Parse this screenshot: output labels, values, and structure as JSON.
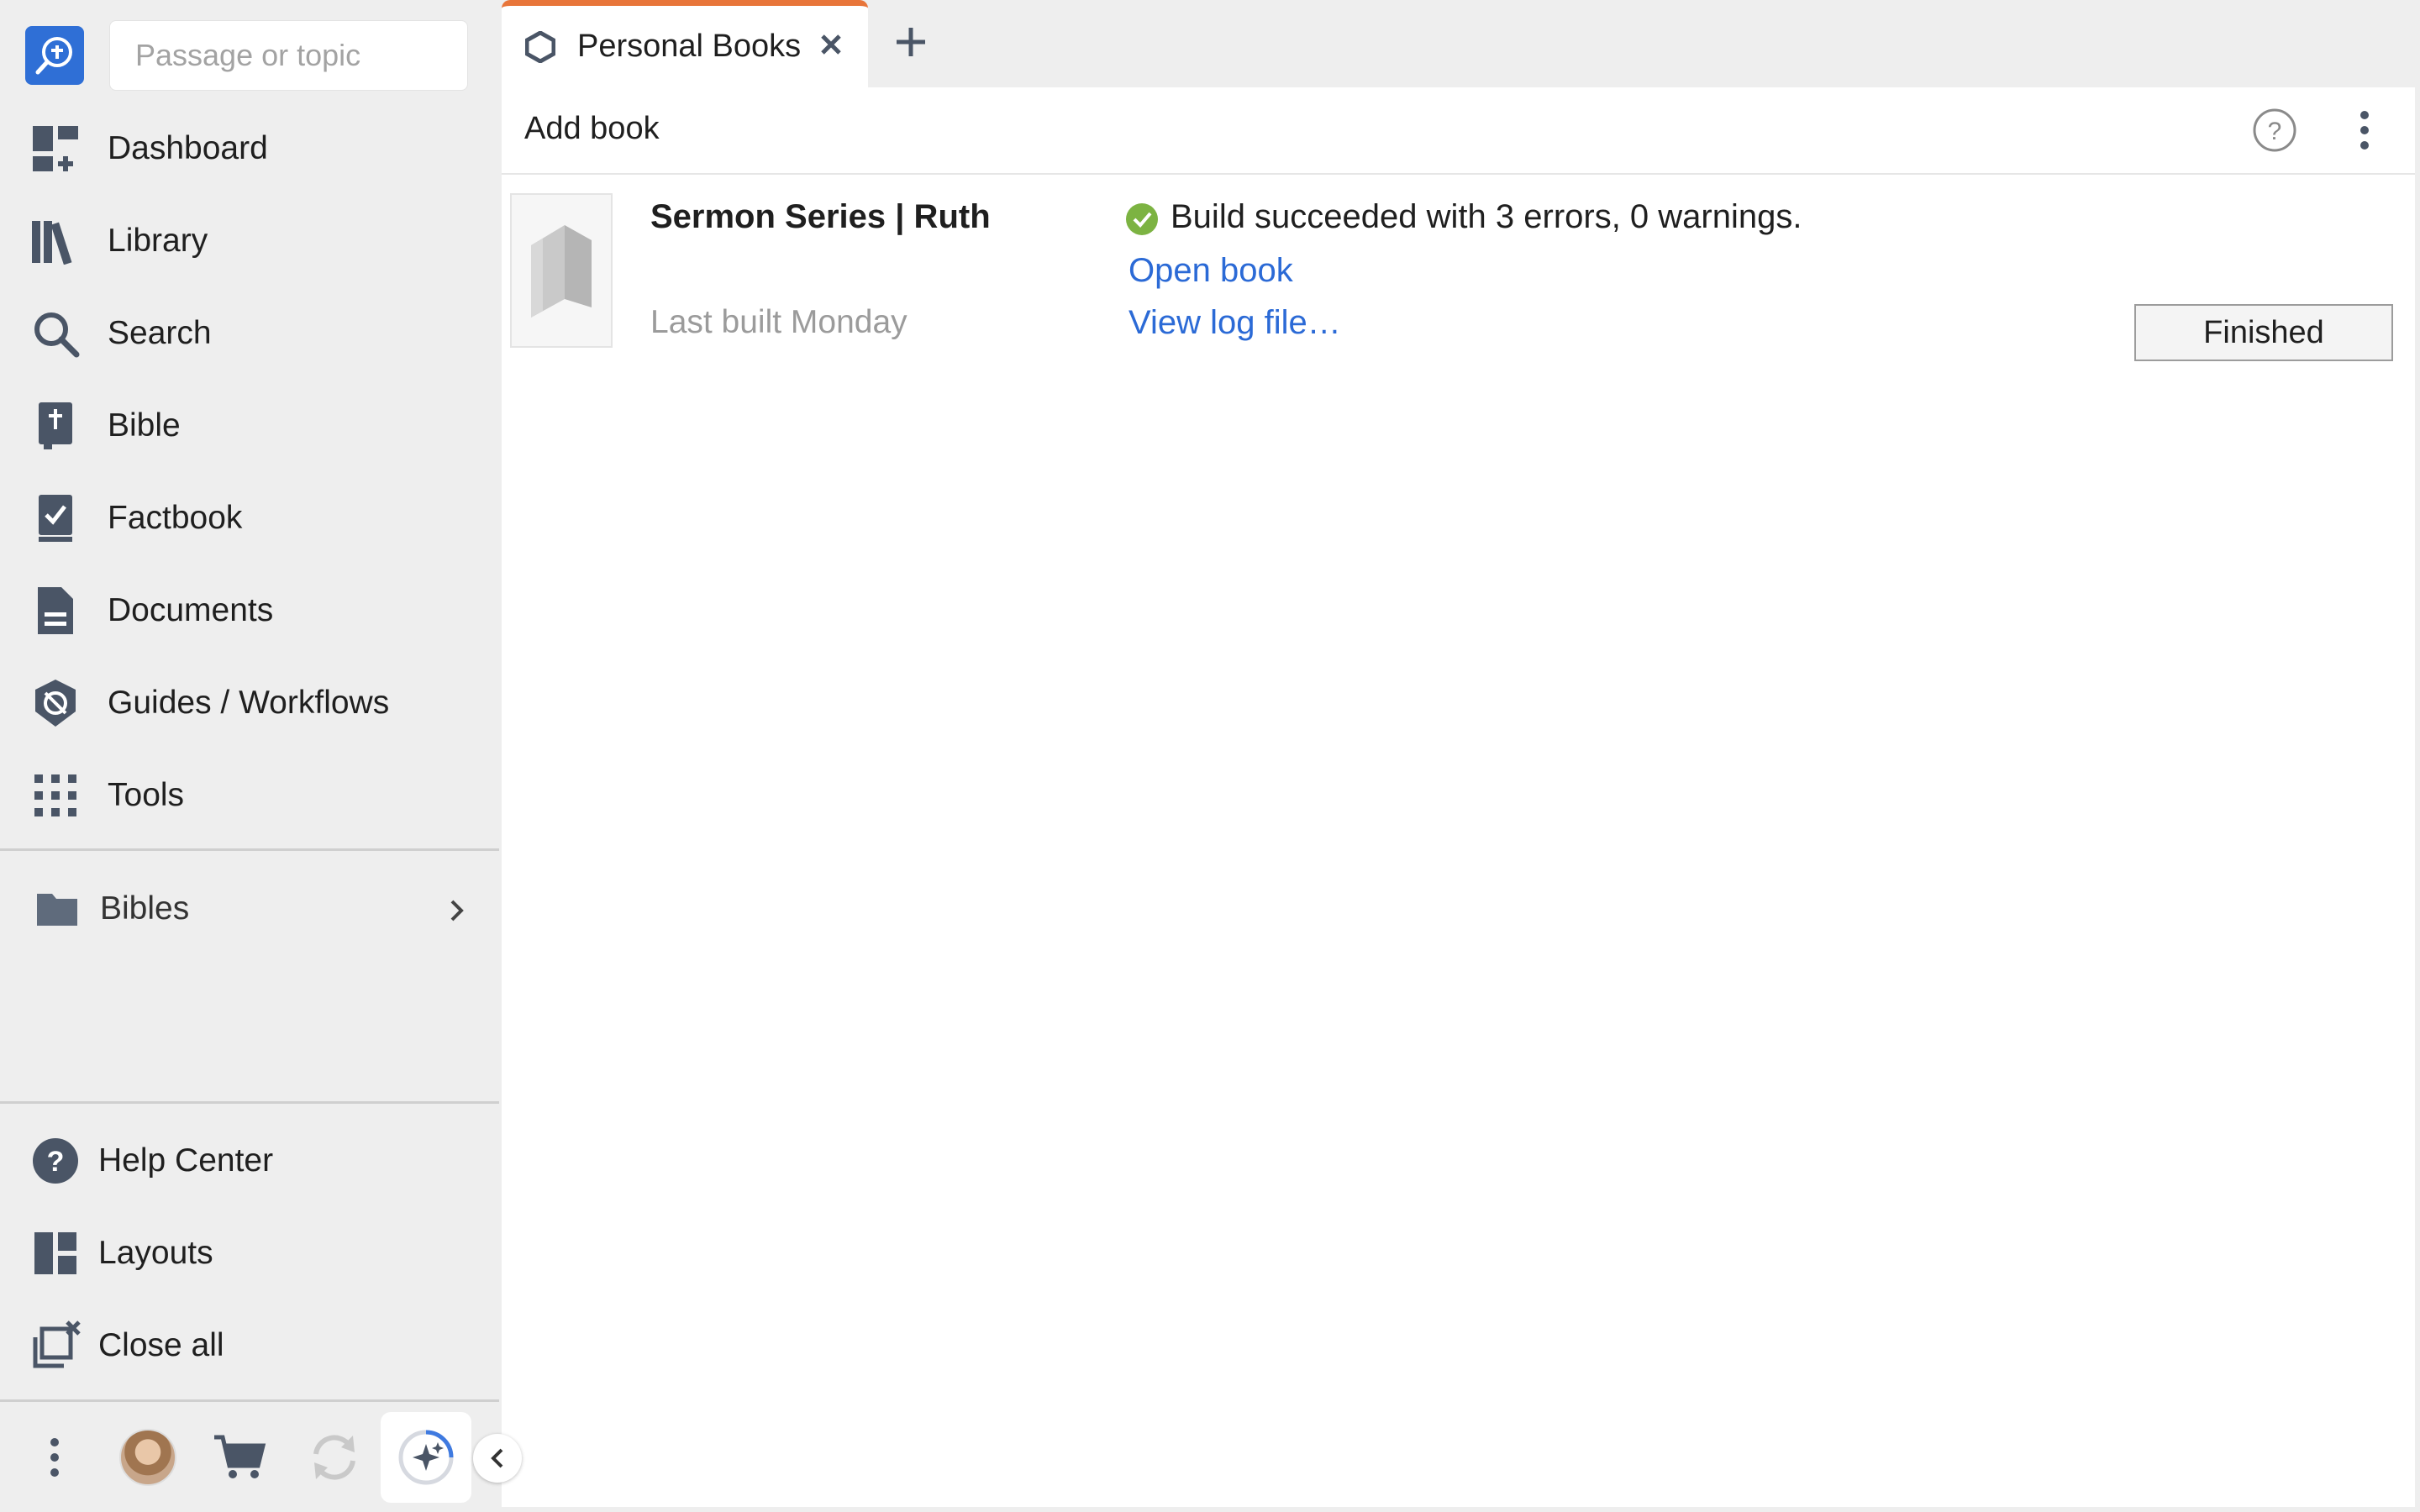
{
  "search": {
    "placeholder": "Passage or topic"
  },
  "nav": {
    "items": [
      {
        "label": "Dashboard",
        "icon": "dashboard-icon"
      },
      {
        "label": "Library",
        "icon": "library-icon"
      },
      {
        "label": "Search",
        "icon": "search-icon"
      },
      {
        "label": "Bible",
        "icon": "bible-icon"
      },
      {
        "label": "Factbook",
        "icon": "factbook-icon"
      },
      {
        "label": "Documents",
        "icon": "documents-icon"
      },
      {
        "label": "Guides / Workflows",
        "icon": "guides-icon"
      },
      {
        "label": "Tools",
        "icon": "tools-icon"
      }
    ],
    "folder": {
      "label": "Bibles",
      "icon": "folder-icon"
    },
    "bottom_items": [
      {
        "label": "Help Center",
        "icon": "help-circle-icon"
      },
      {
        "label": "Layouts",
        "icon": "layouts-icon"
      },
      {
        "label": "Close all",
        "icon": "close-all-icon"
      }
    ]
  },
  "tabs": [
    {
      "label": "Personal Books",
      "active": true,
      "accent": "#e8753a"
    }
  ],
  "panel": {
    "title": "Add book",
    "book": {
      "title": "Sermon Series | Ruth",
      "last_built": "Last built Monday",
      "status": "Build succeeded with 3 errors, 0 warnings.",
      "status_color": "#7cb342",
      "open_link": "Open book",
      "log_link": "View log file…",
      "button": "Finished"
    }
  },
  "colors": {
    "brand": "#2f6fd6",
    "link": "#2b6ad6",
    "icon": "#4a5566"
  }
}
